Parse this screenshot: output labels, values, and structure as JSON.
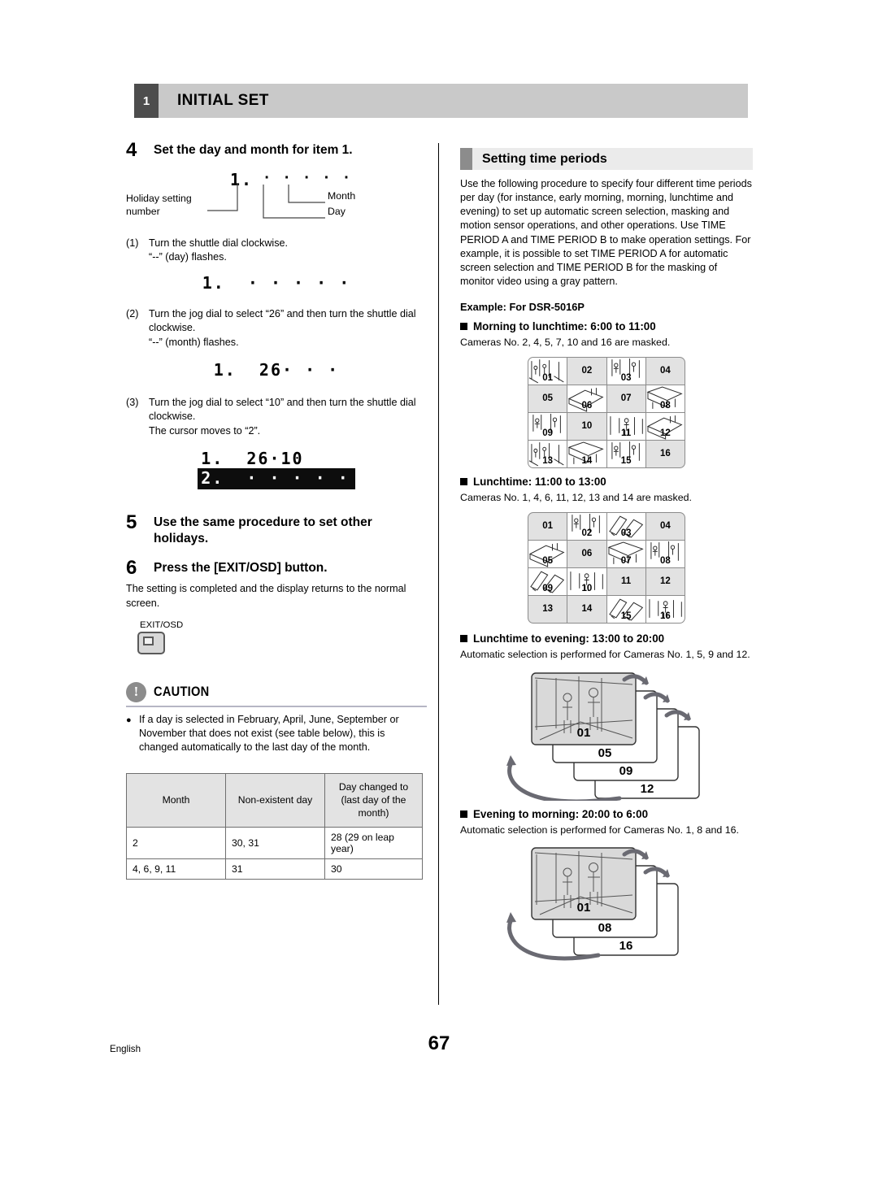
{
  "header": {
    "chapter_number": "1",
    "chapter_title": "INITIAL SET"
  },
  "footer": {
    "language": "English",
    "page_number": "67"
  },
  "left": {
    "step4": {
      "num": "4",
      "title": "Set the day and month for item 1.",
      "diagram": {
        "display": "1.",
        "dots": "· · · · ·",
        "label_holiday": "Holiday setting\nnumber",
        "label_month": "Month",
        "label_day": "Day"
      },
      "substeps": [
        {
          "num": "(1)",
          "text": "Turn the shuttle dial clockwise.\n“--” (day) flashes.",
          "lcd": "1.  · · · · ·"
        },
        {
          "num": "(2)",
          "text": "Turn the jog dial to select “26” and then turn the shuttle dial clockwise.\n“--” (month) flashes.",
          "lcd": "1.  26· · ·"
        },
        {
          "num": "(3)",
          "text": "Turn the jog dial to select “10” and then turn the shuttle dial clockwise.\nThe cursor moves to “2”.",
          "lcd_line1": "1.  26·10",
          "lcd_line2": "2.  · · · · ·"
        }
      ]
    },
    "step5": {
      "num": "5",
      "title": "Use the same procedure to set other holidays."
    },
    "step6": {
      "num": "6",
      "title": "Press the [EXIT/OSD] button.",
      "body": "The setting is completed and the display returns to the normal screen.",
      "button_caption": "EXIT/OSD"
    },
    "caution": {
      "icon_char": "!",
      "title": "CAUTION",
      "items": [
        "If a day is selected in February, April, June, September or November that does not exist (see table below), this is changed automatically to the last day of the month."
      ],
      "table": {
        "headers": [
          "Month",
          "Non-existent day",
          "Day changed to (last day of the month)"
        ],
        "header3_lines": [
          "Day changed to",
          "(last day of the",
          "month)"
        ],
        "rows": [
          [
            "2",
            "30, 31",
            "28 (29 on leap year)"
          ],
          [
            "4, 6, 9, 11",
            "31",
            "30"
          ]
        ]
      }
    }
  },
  "right": {
    "section_title": "Setting time periods",
    "intro": "Use the following procedure to specify four different time periods per day (for instance, early morning, morning, lunchtime and evening) to set up automatic screen selection, masking and motion sensor operations, and other operations. Use TIME PERIOD A and TIME PERIOD B to make operation settings. For example, it is possible to set TIME PERIOD A for automatic screen selection and TIME PERIOD B for the masking of monitor video using a gray pattern.",
    "example_label": "Example: For DSR-5016P",
    "blocks": [
      {
        "heading": "Morning to lunchtime: 6:00 to 11:00",
        "note": "Cameras No. 2, 4, 5, 7, 10 and 16 are masked.",
        "type": "grid",
        "cells": [
          "01",
          "02",
          "03",
          "04",
          "05",
          "06",
          "07",
          "08",
          "09",
          "10",
          "11",
          "12",
          "13",
          "14",
          "15",
          "16"
        ],
        "masked": [
          "02",
          "04",
          "05",
          "07",
          "10",
          "16"
        ]
      },
      {
        "heading": "Lunchtime: 11:00 to 13:00",
        "note": "Cameras No. 1, 4, 6, 11, 12, 13 and 14 are masked.",
        "type": "grid",
        "cells": [
          "01",
          "02",
          "03",
          "04",
          "05",
          "06",
          "07",
          "08",
          "09",
          "10",
          "11",
          "12",
          "13",
          "14",
          "15",
          "16"
        ],
        "masked": [
          "01",
          "04",
          "06",
          "11",
          "12",
          "13",
          "14"
        ]
      },
      {
        "heading": "Lunchtime to evening: 13:00 to 20:00",
        "note": "Automatic selection is performed for Cameras No. 1, 5, 9 and 12.",
        "type": "stack",
        "stack_labels": [
          "01",
          "05",
          "09",
          "12"
        ]
      },
      {
        "heading": "Evening to morning: 20:00 to 6:00",
        "note": "Automatic selection is performed for Cameras No. 1, 8 and 16.",
        "type": "stack",
        "stack_labels": [
          "01",
          "08",
          "16"
        ]
      }
    ]
  }
}
